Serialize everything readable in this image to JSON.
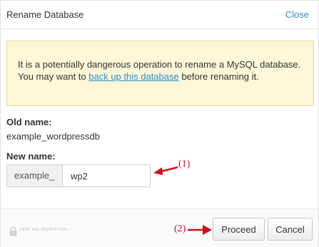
{
  "header": {
    "title": "Rename Database",
    "close_label": "Close"
  },
  "warning": {
    "text_before": "It is a potentially dangerous operation to rename a MySQL database. You may want to ",
    "link_text": "back up this database",
    "text_after": " before renaming it."
  },
  "old_name": {
    "label": "Old name:",
    "value": "example_wordpressdb"
  },
  "new_name": {
    "label": "New name:",
    "prefix": "example_",
    "value": "wp2"
  },
  "footer": {
    "badge_text": "FREE SSL ENCRYPTION",
    "proceed_label": "Proceed",
    "cancel_label": "Cancel"
  },
  "annotations": {
    "step1": "(1)",
    "step2": "(2)",
    "color": "#c8121b"
  },
  "colors": {
    "link": "#2c8fc9",
    "warning_bg": "#fdf6d8",
    "warning_border": "#efd98a"
  }
}
